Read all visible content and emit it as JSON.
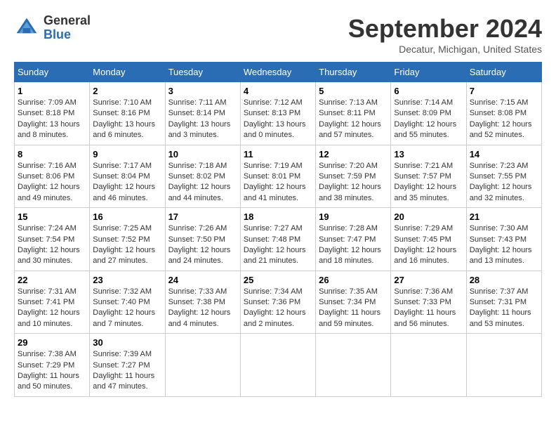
{
  "header": {
    "logo_general": "General",
    "logo_blue": "Blue",
    "month_title": "September 2024",
    "location": "Decatur, Michigan, United States"
  },
  "columns": [
    "Sunday",
    "Monday",
    "Tuesday",
    "Wednesday",
    "Thursday",
    "Friday",
    "Saturday"
  ],
  "weeks": [
    [
      {
        "day": "1",
        "info": "Sunrise: 7:09 AM\nSunset: 8:18 PM\nDaylight: 13 hours\nand 8 minutes."
      },
      {
        "day": "2",
        "info": "Sunrise: 7:10 AM\nSunset: 8:16 PM\nDaylight: 13 hours\nand 6 minutes."
      },
      {
        "day": "3",
        "info": "Sunrise: 7:11 AM\nSunset: 8:14 PM\nDaylight: 13 hours\nand 3 minutes."
      },
      {
        "day": "4",
        "info": "Sunrise: 7:12 AM\nSunset: 8:13 PM\nDaylight: 13 hours\nand 0 minutes."
      },
      {
        "day": "5",
        "info": "Sunrise: 7:13 AM\nSunset: 8:11 PM\nDaylight: 12 hours\nand 57 minutes."
      },
      {
        "day": "6",
        "info": "Sunrise: 7:14 AM\nSunset: 8:09 PM\nDaylight: 12 hours\nand 55 minutes."
      },
      {
        "day": "7",
        "info": "Sunrise: 7:15 AM\nSunset: 8:08 PM\nDaylight: 12 hours\nand 52 minutes."
      }
    ],
    [
      {
        "day": "8",
        "info": "Sunrise: 7:16 AM\nSunset: 8:06 PM\nDaylight: 12 hours\nand 49 minutes."
      },
      {
        "day": "9",
        "info": "Sunrise: 7:17 AM\nSunset: 8:04 PM\nDaylight: 12 hours\nand 46 minutes."
      },
      {
        "day": "10",
        "info": "Sunrise: 7:18 AM\nSunset: 8:02 PM\nDaylight: 12 hours\nand 44 minutes."
      },
      {
        "day": "11",
        "info": "Sunrise: 7:19 AM\nSunset: 8:01 PM\nDaylight: 12 hours\nand 41 minutes."
      },
      {
        "day": "12",
        "info": "Sunrise: 7:20 AM\nSunset: 7:59 PM\nDaylight: 12 hours\nand 38 minutes."
      },
      {
        "day": "13",
        "info": "Sunrise: 7:21 AM\nSunset: 7:57 PM\nDaylight: 12 hours\nand 35 minutes."
      },
      {
        "day": "14",
        "info": "Sunrise: 7:23 AM\nSunset: 7:55 PM\nDaylight: 12 hours\nand 32 minutes."
      }
    ],
    [
      {
        "day": "15",
        "info": "Sunrise: 7:24 AM\nSunset: 7:54 PM\nDaylight: 12 hours\nand 30 minutes."
      },
      {
        "day": "16",
        "info": "Sunrise: 7:25 AM\nSunset: 7:52 PM\nDaylight: 12 hours\nand 27 minutes."
      },
      {
        "day": "17",
        "info": "Sunrise: 7:26 AM\nSunset: 7:50 PM\nDaylight: 12 hours\nand 24 minutes."
      },
      {
        "day": "18",
        "info": "Sunrise: 7:27 AM\nSunset: 7:48 PM\nDaylight: 12 hours\nand 21 minutes."
      },
      {
        "day": "19",
        "info": "Sunrise: 7:28 AM\nSunset: 7:47 PM\nDaylight: 12 hours\nand 18 minutes."
      },
      {
        "day": "20",
        "info": "Sunrise: 7:29 AM\nSunset: 7:45 PM\nDaylight: 12 hours\nand 16 minutes."
      },
      {
        "day": "21",
        "info": "Sunrise: 7:30 AM\nSunset: 7:43 PM\nDaylight: 12 hours\nand 13 minutes."
      }
    ],
    [
      {
        "day": "22",
        "info": "Sunrise: 7:31 AM\nSunset: 7:41 PM\nDaylight: 12 hours\nand 10 minutes."
      },
      {
        "day": "23",
        "info": "Sunrise: 7:32 AM\nSunset: 7:40 PM\nDaylight: 12 hours\nand 7 minutes."
      },
      {
        "day": "24",
        "info": "Sunrise: 7:33 AM\nSunset: 7:38 PM\nDaylight: 12 hours\nand 4 minutes."
      },
      {
        "day": "25",
        "info": "Sunrise: 7:34 AM\nSunset: 7:36 PM\nDaylight: 12 hours\nand 2 minutes."
      },
      {
        "day": "26",
        "info": "Sunrise: 7:35 AM\nSunset: 7:34 PM\nDaylight: 11 hours\nand 59 minutes."
      },
      {
        "day": "27",
        "info": "Sunrise: 7:36 AM\nSunset: 7:33 PM\nDaylight: 11 hours\nand 56 minutes."
      },
      {
        "day": "28",
        "info": "Sunrise: 7:37 AM\nSunset: 7:31 PM\nDaylight: 11 hours\nand 53 minutes."
      }
    ],
    [
      {
        "day": "29",
        "info": "Sunrise: 7:38 AM\nSunset: 7:29 PM\nDaylight: 11 hours\nand 50 minutes."
      },
      {
        "day": "30",
        "info": "Sunrise: 7:39 AM\nSunset: 7:27 PM\nDaylight: 11 hours\nand 47 minutes."
      },
      {
        "day": "",
        "info": ""
      },
      {
        "day": "",
        "info": ""
      },
      {
        "day": "",
        "info": ""
      },
      {
        "day": "",
        "info": ""
      },
      {
        "day": "",
        "info": ""
      }
    ]
  ]
}
